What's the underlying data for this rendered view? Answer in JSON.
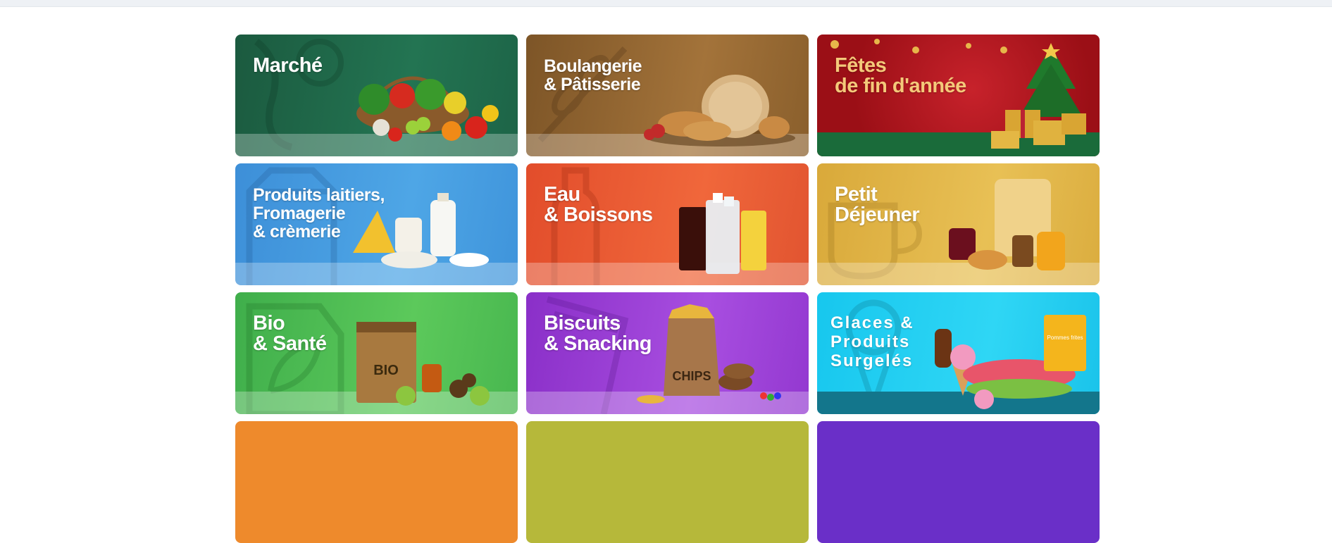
{
  "categories": [
    {
      "label": "Marché"
    },
    {
      "label": "Boulangerie\n& Pâtisserie"
    },
    {
      "label": "Fêtes\nde fin d'année"
    },
    {
      "label": "Produits laitiers,\nFromagerie\n& crèmerie"
    },
    {
      "label": "Eau\n& Boissons"
    },
    {
      "label": "Petit\nDéjeuner"
    },
    {
      "label": "Bio\n& Santé"
    },
    {
      "label": "Biscuits\n& Snacking"
    },
    {
      "label": "Glaces &\nProduits\nSurgelés"
    }
  ],
  "product_labels": {
    "bio_bag": "BIO",
    "chips_bag": "CHIPS",
    "frozen_pack": "Pommes frites"
  },
  "colors": {
    "marche": "#237452",
    "boulangerie": "#a3733a",
    "fetes": "#c7222b",
    "laitiers": "#4ea6e6",
    "boissons": "#f0673b",
    "petit_dejeuner": "#e8c055",
    "bio": "#5cc95b",
    "biscuits": "#a84ee0",
    "surgeles": "#2fd6f5",
    "row4_orange": "#ee8a2c",
    "row4_olive": "#b6b83a",
    "row4_purple": "#6a2fc8"
  }
}
